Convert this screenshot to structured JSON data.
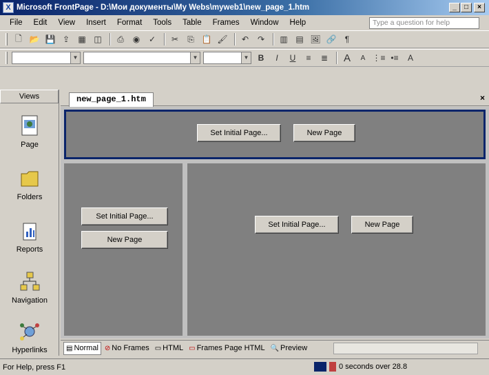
{
  "window": {
    "title": "Microsoft FrontPage - D:\\Мои документы\\My Webs\\myweb1\\new_page_1.htm",
    "minimize": "_",
    "restore": "□",
    "close": "×"
  },
  "menu": {
    "items": [
      "File",
      "Edit",
      "View",
      "Insert",
      "Format",
      "Tools",
      "Table",
      "Frames",
      "Window",
      "Help"
    ],
    "ask_placeholder": "Type a question for help"
  },
  "views_bar": {
    "header": "Views",
    "items": [
      {
        "label": "Page",
        "icon": "page-view-icon"
      },
      {
        "label": "Folders",
        "icon": "folder-icon"
      },
      {
        "label": "Reports",
        "icon": "reports-icon"
      },
      {
        "label": "Navigation",
        "icon": "navigation-icon"
      },
      {
        "label": "Hyperlinks",
        "icon": "hyperlinks-icon"
      }
    ]
  },
  "editor": {
    "tab_label": "new_page_1.htm",
    "close_glyph": "×"
  },
  "frames": {
    "set_initial_page": "Set Initial Page...",
    "new_page": "New Page"
  },
  "view_tabs": [
    {
      "label": "Normal",
      "glyph": "▤",
      "active": true
    },
    {
      "label": "No Frames",
      "glyph": "⊘",
      "active": false
    },
    {
      "label": "HTML",
      "glyph": "▭",
      "active": false
    },
    {
      "label": "Frames Page HTML",
      "glyph": "▭",
      "active": false
    },
    {
      "label": "Preview",
      "glyph": "🔍",
      "active": false
    }
  ],
  "status": {
    "help_text": "For Help, press F1",
    "timing": "0 seconds over 28.8"
  },
  "colors": {
    "title_start": "#0a246a",
    "title_end": "#a6caf0",
    "frame_bg": "#808080",
    "selected_frame_border": "#0a246a"
  }
}
